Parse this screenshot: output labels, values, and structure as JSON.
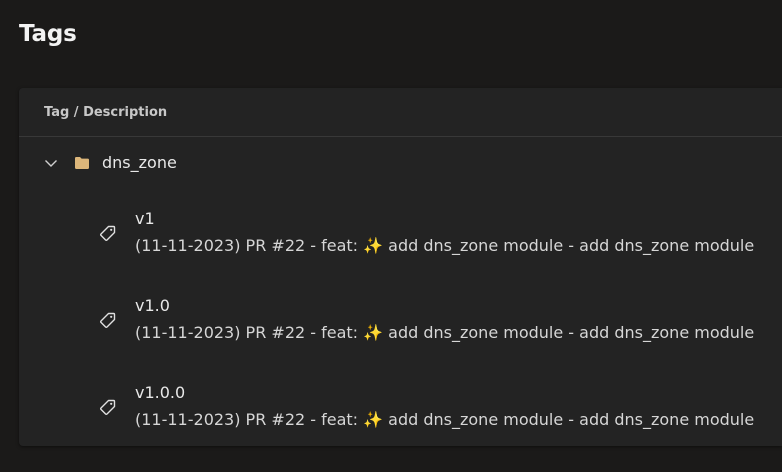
{
  "page": {
    "title": "Tags"
  },
  "table": {
    "column_header": "Tag / Description",
    "folder": {
      "name": "dns_zone",
      "expanded": true,
      "expand_icon": "chevron-down-icon",
      "icon": "folder-icon",
      "icon_color": "#dcb67a"
    },
    "items": [
      {
        "icon": "tag-icon",
        "name": "v1",
        "description": "(11-11-2023) PR #22 - feat: ✨ add dns_zone module - add dns_zone module"
      },
      {
        "icon": "tag-icon",
        "name": "v1.0",
        "description": "(11-11-2023) PR #22 - feat: ✨ add dns_zone module - add dns_zone module"
      },
      {
        "icon": "tag-icon",
        "name": "v1.0.0",
        "description": "(11-11-2023) PR #22 - feat: ✨ add dns_zone module - add dns_zone module"
      }
    ]
  }
}
